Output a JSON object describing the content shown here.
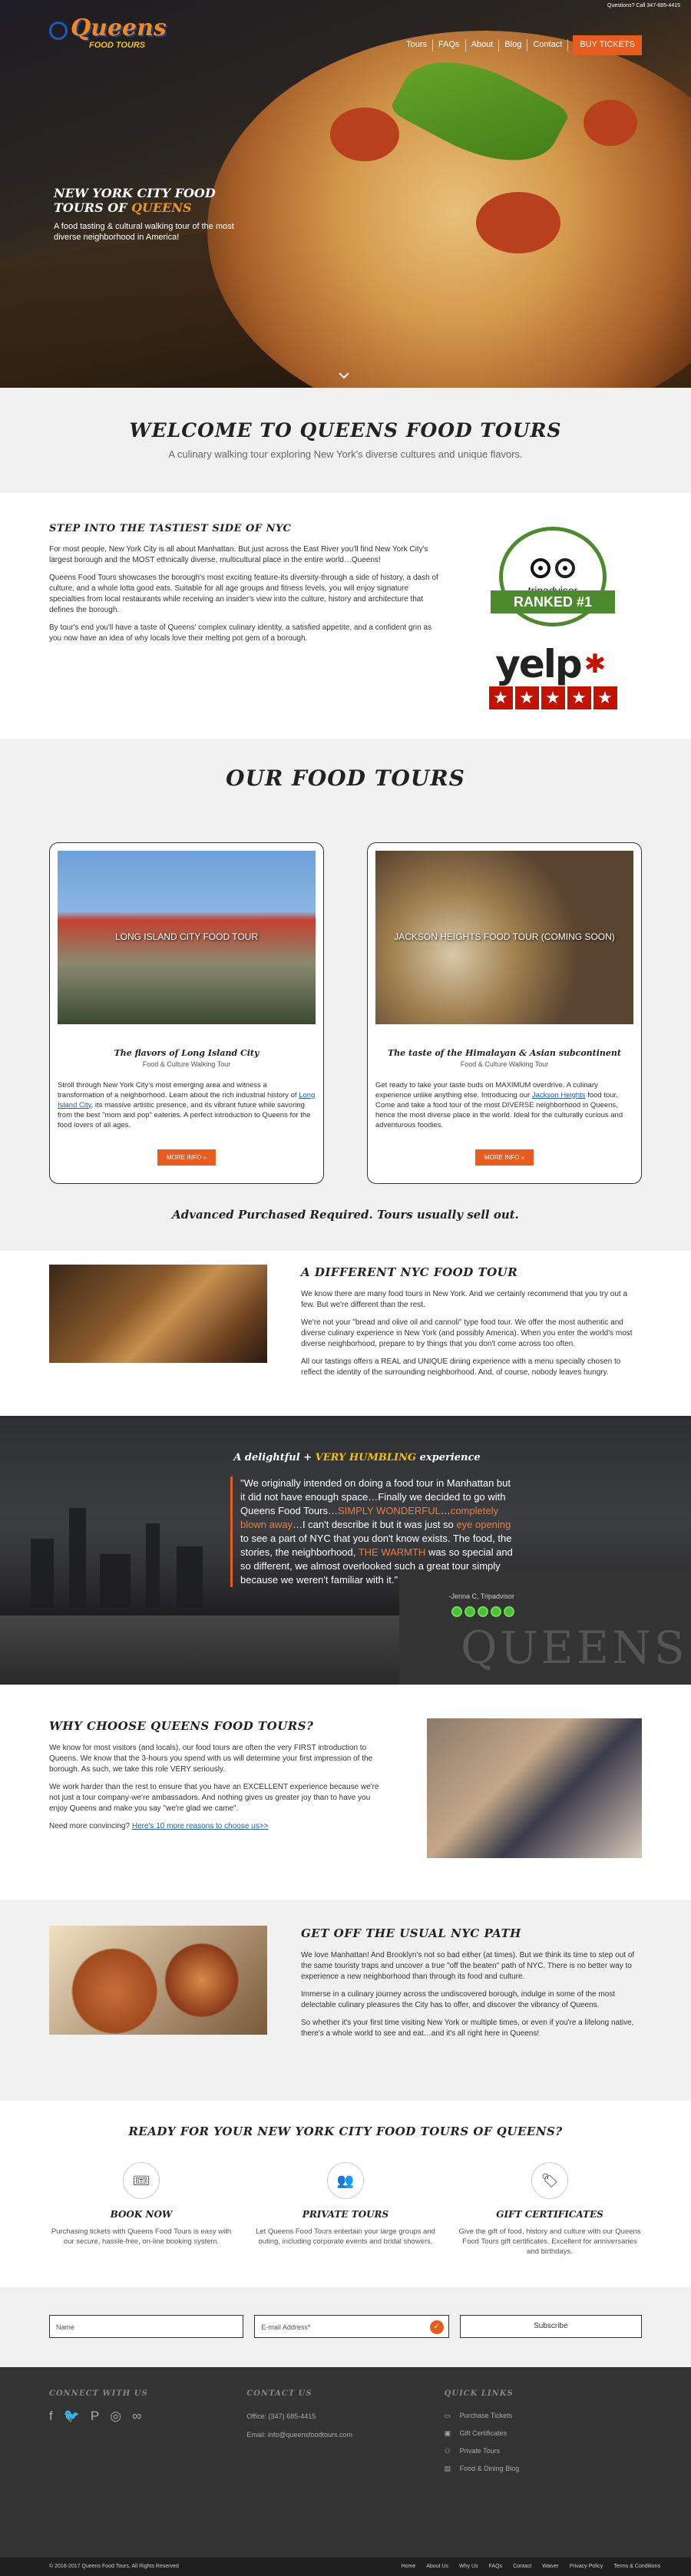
{
  "topbar": {
    "text": "Questions? Call 347-685-4415"
  },
  "logo": {
    "line1": "Queens",
    "line2": "FOOD TOURS"
  },
  "nav": {
    "items": [
      "Tours",
      "FAQs",
      "About",
      "Blog",
      "Contact"
    ],
    "buy": "BUY TICKETS"
  },
  "hero": {
    "title_white": "NEW YORK CITY FOOD TOURS OF",
    "title_orange": "QUEENS",
    "subtitle": "A food tasting & cultural walking tour of the most diverse neighborhood in America!"
  },
  "welcome": {
    "title": "WELCOME TO QUEENS FOOD TOURS",
    "subtitle": "A culinary walking tour exploring New York's diverse cultures and unique flavors."
  },
  "tastiest": {
    "title": "STEP INTO THE TASTIEST SIDE OF NYC",
    "p1": "For most people, New York City is all about Manhattan. But just across the East River you'll find New York City's largest borough and the MOST ethnically diverse, multicultural place in the entire world…Queens!",
    "p2": "Queens Food Tours showcases the borough's most exciting feature-its diversity-through a side of history, a dash of culture, and a whole lotta good eats. Suitable for all age groups and fitness levels, you will enjoy signature specialties from local restaurants while receiving an insider's view into the culture, history and architecture that defines the borough.",
    "p3": "By tour's end you'll have a taste of Queens' complex culinary identity, a satisfied appetite, and a confident grin as you now have an idea of why locals love their melting pot gem of a borough.",
    "trip_name": "tripadvisor",
    "trip_rank": "RANKED #1",
    "yelp": "yelp"
  },
  "tours": {
    "title": "OUR FOOD TOURS",
    "cards": [
      {
        "photo_label": "LONG ISLAND CITY FOOD TOUR",
        "title": "The flavors of Long Island City",
        "subtitle": "Food & Culture Walking Tour",
        "desc_a": "Stroll through New York City's most emerging area and witness a transformation of a neighborhood. Learn about the rich industrial history of ",
        "desc_link": "Long Island City",
        "desc_b": ", its massive artistic presence, and its vibrant future while savoring from the best \"mom and pop\" eateries. A perfect introduction to Queens for the food lovers of all ages.",
        "btn": "MORE INFO »"
      },
      {
        "photo_label": "JACKSON HEIGHTS FOOD TOUR (COMING SOON)",
        "title": "The taste of the Himalayan & Asian subcontinent",
        "subtitle": "Food & Culture Walking Tour",
        "desc_a": "Get ready to take your taste buds on MAXIMUM overdrive. A culinary experience unlike anything else. Introducing our ",
        "desc_link": "Jackson Heights",
        "desc_b": " food tour. Come and take a food tour of the most DIVERSE neighborhood in Queens, hence the most diverse place in the world. Ideal for the culturally curious and adventurous foodies.",
        "btn": "MORE INFO »"
      }
    ],
    "note": "Advanced Purchased Required. Tours usually sell out."
  },
  "different": {
    "title": "A DIFFERENT NYC FOOD TOUR",
    "p1": "We know there are many food tours in New York. And we certainly recommend that you try out a few. But we're different than the rest.",
    "p2": "We're not your \"bread and olive oil and cannoli\" type food tour. We offer the most authentic and diverse culinary experience in New York (and possibly America). When you enter the world's most diverse neighborhood, prepare to try things that you don't come across too often.",
    "p3": "All our tastings offers a REAL and UNIQUE dining experience with a menu specially chosen to reflect the identity of the surrounding neighborhood. And, of course, nobody leaves hungry."
  },
  "quote": {
    "head_a": "A delightful + ",
    "head_b": "VERY HUMBLING",
    "head_c": " experience",
    "t1": "\"We originally intended on doing a food tour in Manhattan but it did not have enough space…Finally we decided to go with Queens Food Tours…",
    "h1": "SIMPLY WONDERFUL",
    "t2": "…",
    "h2": "completely blown away",
    "t3": "…I can't describe it but it was just so ",
    "h3": "eye opening",
    "t4": " to see a part of NYC that you don't know exists. The food, the stories, the neighborhood, ",
    "h4": "THE WARMTH",
    "t5": " was so special and so different, we almost overlooked such a great tour simply because we weren't familiar with it.\"",
    "by": "-Jenna C, Tripadvisor",
    "wall": "QUEENS"
  },
  "why": {
    "title": "WHY CHOOSE QUEENS FOOD TOURS?",
    "p1": "We know for most visitors (and locals), our food tours are often the very FIRST introduction to Queens. We know that the 3-hours you spend with us will determine your first impression of the borough. As such, we take this role VERY seriously.",
    "p2": "We work harder than the rest to ensure that you have an EXCELLENT experience because we're not just a tour company-we're ambassadors. And nothing gives us greater joy than to have you enjoy Queens and make you say \"we're glad we came\".",
    "p3_a": "Need more convincing? ",
    "p3_link": "Here's 10 more reasons to choose us>>"
  },
  "usual": {
    "title": "GET OFF THE USUAL NYC PATH",
    "p1": "We love Manhattan! And Brooklyn's not so bad either (at times). But we think its time to step out of the same touristy traps and uncover a true \"off the beaten\" path of NYC. There is no better way to experience a new neighborhood than through its food and culture.",
    "p2": "Immerse in a culinary journey across the undiscovered borough, indulge in some of the most delectable culinary pleasures the City has to offer, and discover the vibrancy of Queens.",
    "p3": "So whether it's your first time visiting New York or multiple times, or even if you're a lifelong native, there's a whole world to see and eat…and it's all right here in Queens!"
  },
  "ready": {
    "title": "READY FOR YOUR NEW YORK CITY FOOD TOURS OF QUEENS?",
    "features": [
      {
        "title": "BOOK NOW",
        "text": "Purchasing tickets with Queens Food Tours is easy with our secure, hassle-free, on-line booking system."
      },
      {
        "title": "PRIVATE TOURS",
        "text": "Let Queens Food Tours entertain your large groups and outing, including corporate events and bridal showers."
      },
      {
        "title": "GIFT CERTIFICATES",
        "text": "Give the gift of food, history and culture with our Queens Food Tours gift certificates. Excellent for anniversaries and birthdays."
      }
    ]
  },
  "signup": {
    "name_placeholder": "Name",
    "email_placeholder": "E-mail Address*",
    "button": "Subscribe"
  },
  "footer": {
    "connect_title": "CONNECT WITH US",
    "contact_title": "CONTACT US",
    "office": "Office: (347) 685-4415",
    "email": "Email: info@queensfoodtours.com",
    "quick_title": "QUICK LINKS",
    "quick_links": [
      "Purchase Tickets",
      "Gift Certificates",
      "Private Tours",
      "Food & Dining Blog"
    ]
  },
  "bottom": {
    "copyright": "© 2016-2017 Queens Food Tours, All Rights Reserved",
    "links": [
      "Home",
      "About Us",
      "Why Us",
      "FAQs",
      "Contact",
      "Waiver",
      "Privacy Policy",
      "Terms & Conditions"
    ]
  }
}
